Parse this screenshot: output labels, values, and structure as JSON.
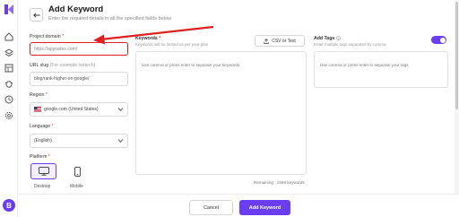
{
  "header": {
    "title": "Add Keyword",
    "subtitle": "Enter the required details in all the specified fields below"
  },
  "sidebar": {
    "avatar_letter": "B",
    "icons": [
      "logo-icon",
      "home-icon",
      "layers-icon",
      "table-icon",
      "bug-icon",
      "clock-icon",
      "settings-icon"
    ]
  },
  "form": {
    "project_domain": {
      "label": "Project domain",
      "placeholder": "https://apprades.com/"
    },
    "url_slug": {
      "label": "URL slug",
      "hint": "(For example /search)",
      "value": "blog/rank-higher-on-google/"
    },
    "region": {
      "label": "Region",
      "value": "google.com (United States)"
    },
    "language": {
      "label": "Language",
      "value": "(English)"
    },
    "platform": {
      "label": "Platform",
      "options": [
        "Desktop",
        "Mobile"
      ],
      "selected": "Desktop"
    }
  },
  "keywords": {
    "label": "Keywords",
    "hint": "Keywords will be limited as per your plan",
    "csv_button": "CSV or Text",
    "placeholder": "Use comma or press enter to separate your keywords",
    "remaining": "Remaining : 1598 keywords"
  },
  "tags": {
    "label": "Add Tags",
    "hint": "Enter multiple tags separated by comma",
    "placeholder": "Use comma or press enter to separate your tags",
    "toggle_on": true
  },
  "footer": {
    "cancel_label": "Cancel",
    "add_label": "Add Keyword"
  },
  "colors": {
    "accent": "#6a3ef0",
    "annotation_red": "#e02020"
  }
}
